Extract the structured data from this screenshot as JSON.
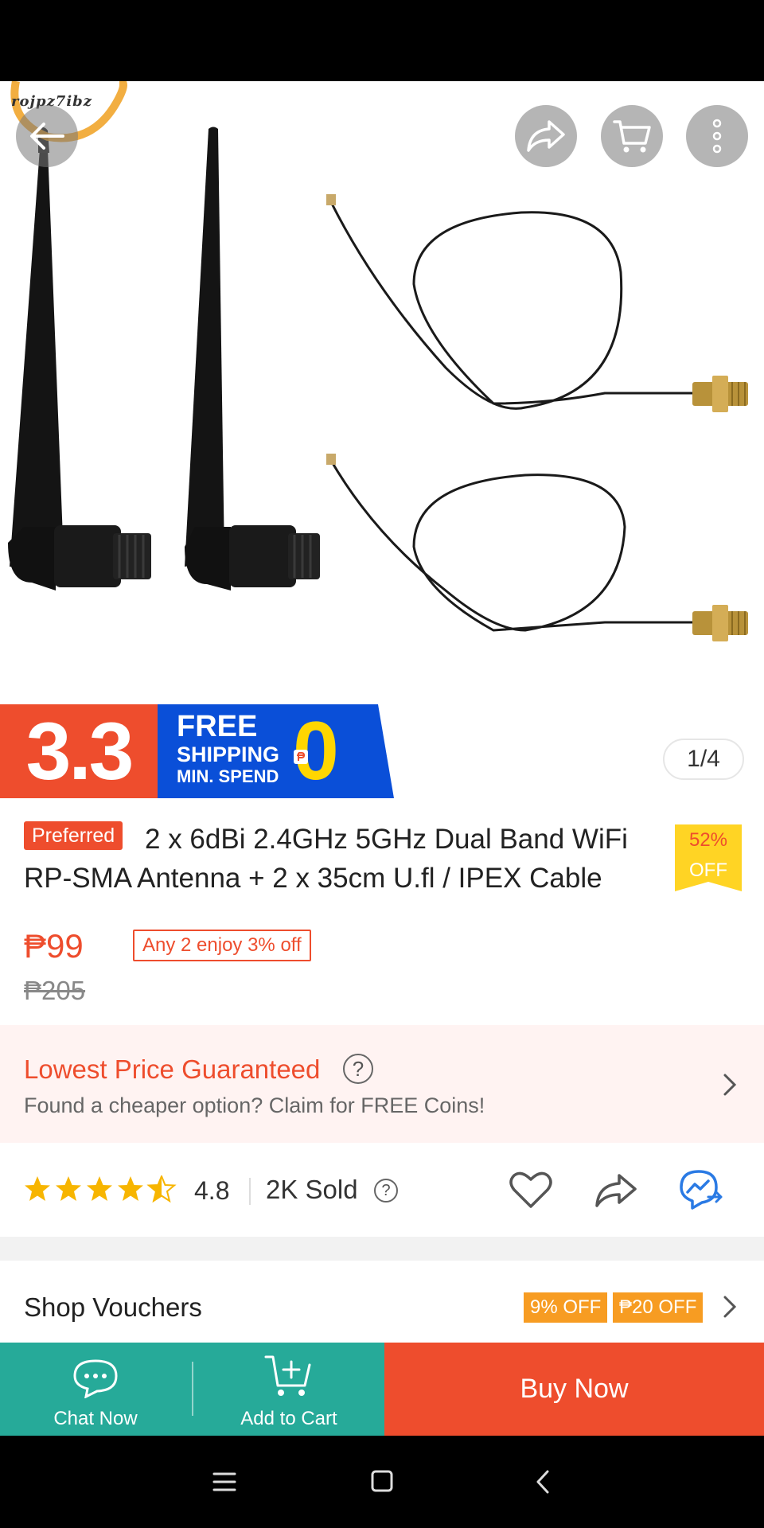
{
  "header": {
    "shop_logo_text": "rojpz7ibz",
    "back_icon": "back-arrow-icon",
    "share_icon": "share-icon",
    "cart_icon": "cart-icon",
    "more_icon": "more-vertical-icon"
  },
  "gallery": {
    "counter": "1/4",
    "current_image": 1,
    "total_images": 4
  },
  "promo_banner": {
    "event": "3.3",
    "line1": "FREE",
    "line2": "SHIPPING",
    "line3": "MIN. SPEND",
    "amount": "0"
  },
  "product": {
    "preferred_badge": "Preferred",
    "title": "2 x 6dBi 2.4GHz 5GHz Dual Band WiFi RP-SMA Antenna + 2 x 35cm U.fl / IPEX Cable",
    "discount_pct": "52%",
    "discount_label": "OFF",
    "price": "₱99",
    "bundle_deal": "Any 2 enjoy 3% off",
    "original_price": "₱205"
  },
  "guarantee": {
    "title": "Lowest Price Guaranteed",
    "help_icon": "?",
    "subtitle": "Found a cheaper option? Claim for FREE Coins!"
  },
  "stats": {
    "rating": "4.8",
    "rating_stars": 4.5,
    "sold": "2K Sold",
    "sold_help": "?"
  },
  "vouchers": {
    "label": "Shop Vouchers",
    "items": [
      "9% OFF",
      "₱20 OFF"
    ]
  },
  "bottom_bar": {
    "chat_label": "Chat Now",
    "cart_label": "Add to Cart",
    "buy_label": "Buy Now"
  },
  "colors": {
    "brand": "#ee4d2d",
    "green": "#26aa99",
    "star": "#f7b500",
    "voucher": "#f79c22",
    "promo_blue": "#0a4fd8"
  }
}
